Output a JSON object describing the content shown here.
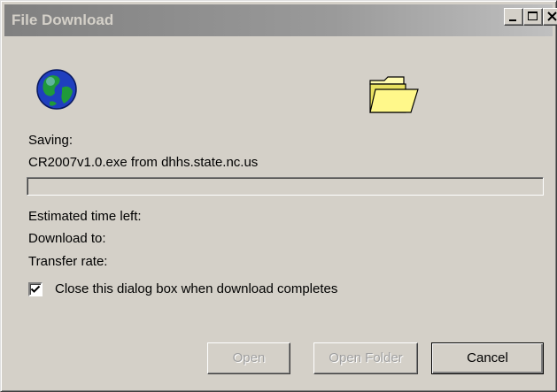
{
  "window": {
    "title": "File Download",
    "controls": {
      "minimize_icon": "minimize-icon",
      "maximize_icon": "maximize-icon",
      "close_icon": "close-icon"
    }
  },
  "icons": {
    "globe": "globe-icon",
    "folder": "folder-icon"
  },
  "status": {
    "saving_label": "Saving:",
    "file_line": "CR2007v1.0.exe from dhhs.state.nc.us",
    "progress": 0,
    "estimated_time_label": "Estimated time left:",
    "download_to_label": "Download to:",
    "transfer_rate_label": "Transfer rate:"
  },
  "options": {
    "close_when_done_label": "Close this dialog box when download completes",
    "close_when_done_checked": true
  },
  "buttons": {
    "open": "Open",
    "open_folder": "Open Folder",
    "cancel": "Cancel"
  },
  "colors": {
    "dialog_bg": "#d4d0c8",
    "titlebar_inactive": "#808080",
    "title_text": "#d4d0c8"
  }
}
